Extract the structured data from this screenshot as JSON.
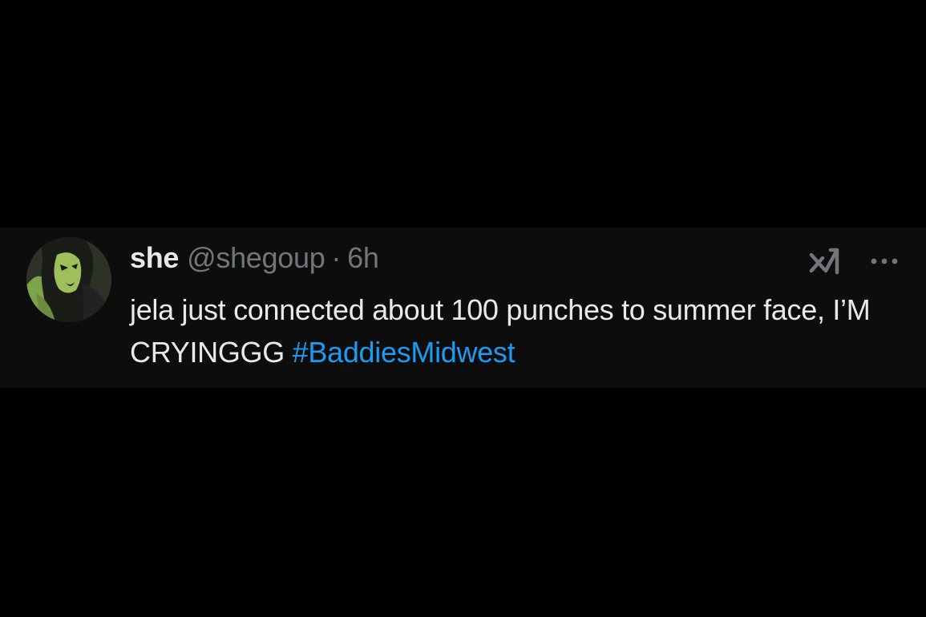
{
  "tweet": {
    "display_name": "she",
    "handle": "@shegoup",
    "separator": "·",
    "timestamp": "6h",
    "text_main": "jela just connected about 100 punches to summer face, I’M CRYINGGG ",
    "hashtag": "#BaddiesMidwest"
  },
  "icons": {
    "avatar": "cartoon-avatar",
    "grok": "grok-icon",
    "more": "more-options-icon"
  },
  "colors": {
    "background": "#000000",
    "card": "#0d0d0d",
    "primary_text": "#e7e9ea",
    "secondary_text": "#71767b",
    "link": "#1d9bf0"
  }
}
